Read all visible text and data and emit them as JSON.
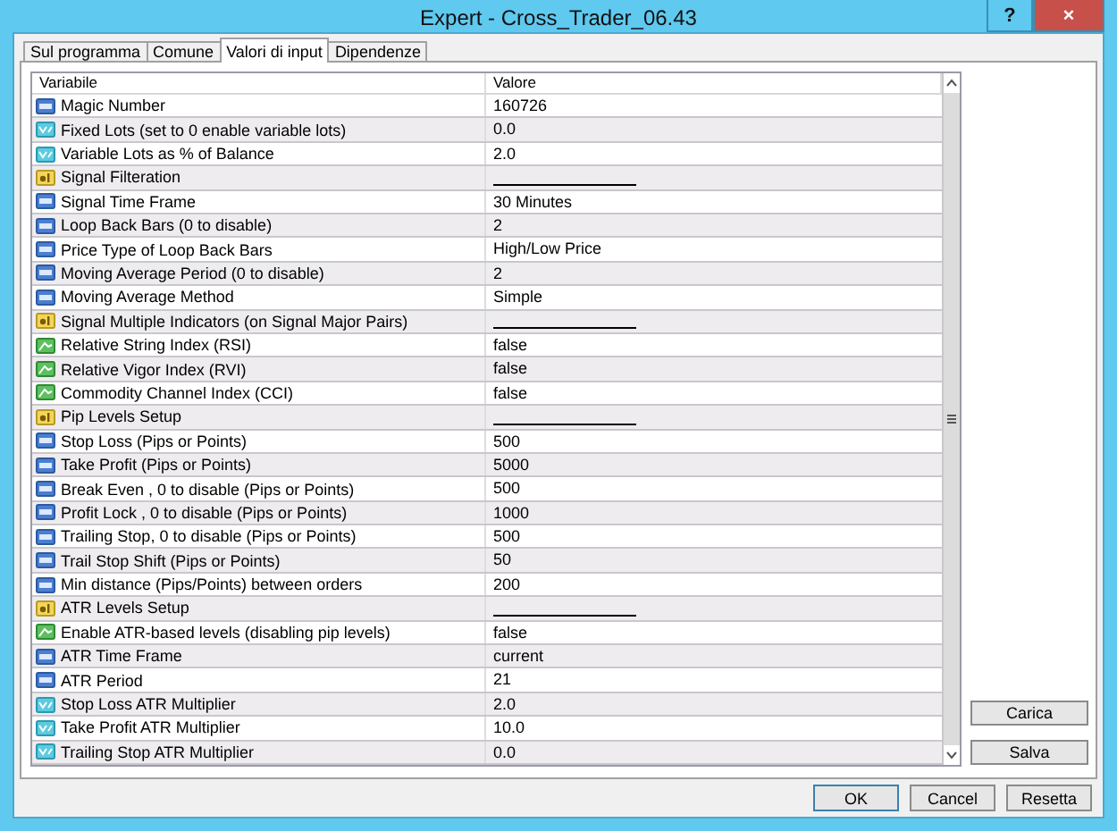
{
  "window": {
    "title": "Expert - Cross_Trader_06.43",
    "controls": [
      "?",
      "×"
    ]
  },
  "tabs": [
    {
      "label": "Sul programma",
      "selected": false
    },
    {
      "label": "Comune",
      "selected": false
    },
    {
      "label": "Valori di input",
      "selected": true
    },
    {
      "label": "Dipendenze",
      "selected": false
    }
  ],
  "table": {
    "columns": [
      "Variabile",
      "Valore"
    ],
    "rows": [
      {
        "kind": "int",
        "name": "Magic Number",
        "value": "160726"
      },
      {
        "kind": "double",
        "name": "Fixed Lots (set to 0 enable variable lots)",
        "value": "0.0"
      },
      {
        "kind": "double",
        "name": "Variable Lots as % of Balance",
        "value": "2.0"
      },
      {
        "kind": "string",
        "name": "Signal Filteration"
      },
      {
        "kind": "int",
        "name": "Signal Time Frame",
        "value": "30 Minutes"
      },
      {
        "kind": "int",
        "name": "Loop Back Bars (0 to disable)",
        "value": "2"
      },
      {
        "kind": "int",
        "name": "Price Type of Loop Back Bars",
        "value": "High/Low Price"
      },
      {
        "kind": "int",
        "name": "Moving Average Period (0 to disable)",
        "value": "2"
      },
      {
        "kind": "int",
        "name": "Moving Average Method",
        "value": "Simple"
      },
      {
        "kind": "string",
        "name": "Signal Multiple Indicators (on Signal Major Pairs)"
      },
      {
        "kind": "bool",
        "name": "Relative String Index (RSI)",
        "value": "false"
      },
      {
        "kind": "bool",
        "name": "Relative Vigor Index (RVI)",
        "value": "false"
      },
      {
        "kind": "bool",
        "name": "Commodity Channel Index (CCI)",
        "value": "false"
      },
      {
        "kind": "string",
        "name": "Pip Levels Setup"
      },
      {
        "kind": "int",
        "name": "Stop Loss (Pips or Points)",
        "value": "500"
      },
      {
        "kind": "int",
        "name": "Take Profit (Pips or Points)",
        "value": "5000"
      },
      {
        "kind": "int",
        "name": "Break Even , 0 to disable (Pips or Points)",
        "value": "500"
      },
      {
        "kind": "int",
        "name": "Profit Lock , 0 to disable (Pips or Points)",
        "value": "1000"
      },
      {
        "kind": "int",
        "name": "Trailing Stop, 0 to disable (Pips or Points)",
        "value": "500"
      },
      {
        "kind": "int",
        "name": "Trail Stop Shift (Pips or Points)",
        "value": "50"
      },
      {
        "kind": "int",
        "name": "Min distance (Pips/Points) between orders",
        "value": "200"
      },
      {
        "kind": "string",
        "name": "ATR Levels Setup"
      },
      {
        "kind": "bool",
        "name": "Enable ATR-based levels (disabling pip levels)",
        "value": "false"
      },
      {
        "kind": "int",
        "name": "ATR Time Frame",
        "value": "current"
      },
      {
        "kind": "int",
        "name": "ATR Period",
        "value": "21"
      },
      {
        "kind": "double",
        "name": "Stop Loss ATR Multiplier",
        "value": "2.0"
      },
      {
        "kind": "double",
        "name": "Take Profit ATR Multiplier",
        "value": "10.0"
      },
      {
        "kind": "double",
        "name": "Trailing Stop ATR Multiplier",
        "value": "0.0"
      }
    ]
  },
  "side_buttons": [
    "Carica",
    "Salva"
  ],
  "buttons": [
    "OK",
    "Cancel",
    "Resetta"
  ]
}
